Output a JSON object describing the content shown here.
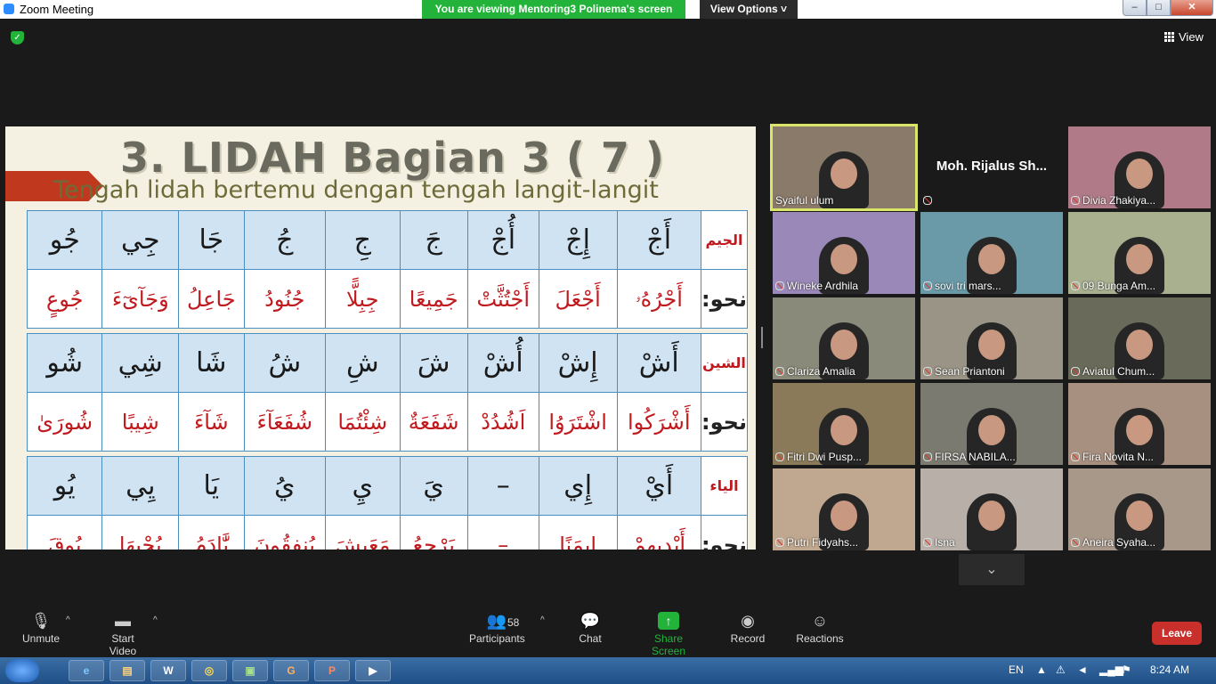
{
  "window": {
    "title": "Zoom Meeting"
  },
  "banner": {
    "viewing": "You are viewing Mentoring3 Polinema's screen",
    "view_options": "View Options ˅"
  },
  "top_right": {
    "view": "View"
  },
  "slide": {
    "title": "3. LIDAH Bagian 3 ( 7 )",
    "subtitle": "Tengah lidah bertemu dengan tengah langit-langit",
    "sections": [
      {
        "label": "الجيم",
        "letters": [
          "أَجْ",
          "إِجْ",
          "أُجْ",
          "جَ",
          "جِ",
          "جُ",
          "جَا",
          "جِي",
          "جُو"
        ],
        "example_label": "نحو:",
        "examples": [
          "أَجْرُهُۥ",
          "أَجْعَلَ",
          "أَجْتُثَّتْ",
          "جَمِيعًا",
          "جِبِلًّا",
          "جُنُودُ",
          "جَاعِلُ",
          "وَجَآىٓءَ",
          "جُوعٍ"
        ]
      },
      {
        "label": "الشين",
        "letters": [
          "أَشْ",
          "إِشْ",
          "أُشْ",
          "شَ",
          "شِ",
          "شُ",
          "شَا",
          "شِي",
          "شُو"
        ],
        "example_label": "نحو:",
        "examples": [
          "أَشْرَكُوا",
          "اشْتَرَوُا",
          "اَشُدُدْ",
          "شَفَعَةٌ",
          "شِئْتُمَا",
          "شُفَعَآءَ",
          "شَآءَ",
          "شِيبًا",
          "شُورَىٰ"
        ]
      },
      {
        "label": "الياء",
        "letters": [
          "أَيْ",
          "إِي",
          "–",
          "يَ",
          "يِ",
          "يُ",
          "يَا",
          "يِي",
          "يُو"
        ],
        "example_label": "نحو:",
        "examples": [
          "أَيْدِيهِمْ",
          "إِيمَنًا",
          "–",
          "يَرْجِعُ",
          "مَعَيِشَ",
          "يُنفِقُونَ",
          "يَّٰادَمُ",
          "يُحْيِهَا",
          "يُوقَ"
        ]
      }
    ]
  },
  "participants_tiles": [
    {
      "name": "Syaiful ulum",
      "muted": false,
      "video": true,
      "active": true
    },
    {
      "name": "Moh. Rijalus Sh...",
      "muted": true,
      "video": false,
      "active": false
    },
    {
      "name": "Divia Zhakiya...",
      "muted": true,
      "video": true,
      "active": false
    },
    {
      "name": "Wineke Ardhila",
      "muted": true,
      "video": true,
      "active": false
    },
    {
      "name": "sovi tri mars...",
      "muted": true,
      "video": true,
      "active": false
    },
    {
      "name": "09 Bunga Am...",
      "muted": true,
      "video": true,
      "active": false
    },
    {
      "name": "Clariza Amalia",
      "muted": true,
      "video": true,
      "active": false
    },
    {
      "name": "Sean Priantoni",
      "muted": true,
      "video": true,
      "active": false
    },
    {
      "name": "Aviatul Chum...",
      "muted": true,
      "video": true,
      "active": false
    },
    {
      "name": "Fitri Dwi Pusp...",
      "muted": true,
      "video": true,
      "active": false
    },
    {
      "name": "FIRSA NABILA...",
      "muted": true,
      "video": true,
      "active": false
    },
    {
      "name": "Fira Novita N...",
      "muted": true,
      "video": true,
      "active": false
    },
    {
      "name": "Putri Fidyahs...",
      "muted": true,
      "video": true,
      "active": false
    },
    {
      "name": "Isna",
      "muted": true,
      "video": true,
      "active": false
    },
    {
      "name": "Aneira Syaha...",
      "muted": true,
      "video": true,
      "active": false
    }
  ],
  "toolbar": {
    "unmute": "Unmute",
    "start_video": "Start Video",
    "participants": "Participants",
    "participants_count": "58",
    "chat": "Chat",
    "share_screen": "Share Screen",
    "record": "Record",
    "reactions": "Reactions",
    "leave": "Leave"
  },
  "taskbar": {
    "language": "EN",
    "time": "8:24 AM",
    "apps": [
      "ie-icon",
      "explorer-icon",
      "word-icon",
      "chrome-icon",
      "folder-icon",
      "app-icon",
      "powerpoint-icon",
      "zoom-icon"
    ]
  },
  "colors": {
    "banner_green": "#23b33a",
    "leave_red": "#c9302c",
    "active_border": "#d9e66a",
    "slide_red": "#c0191e"
  }
}
